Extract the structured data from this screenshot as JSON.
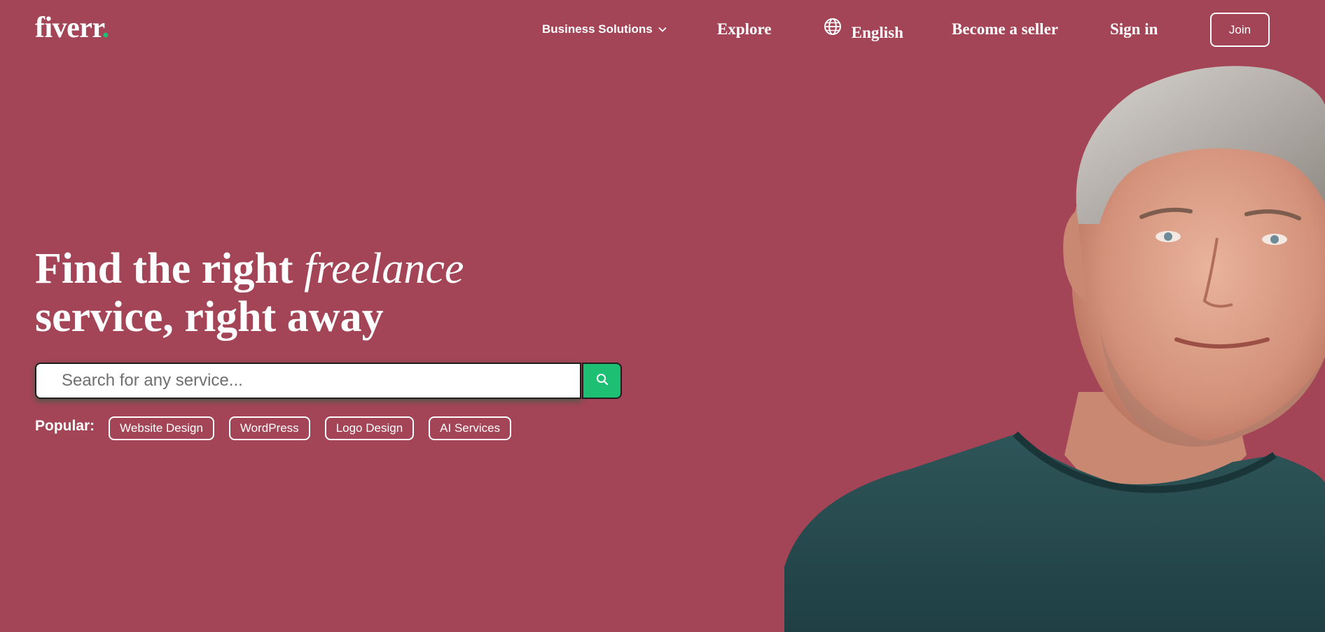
{
  "header": {
    "logo_text": "fiverr",
    "logo_dot": ".",
    "nav": {
      "business_solutions": "Business Solutions",
      "explore": "Explore",
      "language": "English",
      "become_seller": "Become a seller",
      "sign_in": "Sign in",
      "join": "Join"
    }
  },
  "hero": {
    "headline_part1": "Find the right ",
    "headline_emphasis": "freelance",
    "headline_part2": "service, right away",
    "search": {
      "placeholder": "Search for any service..."
    },
    "popular_label": "Popular:",
    "popular_tags": [
      "Website Design",
      "WordPress",
      "Logo Design",
      "AI Services"
    ]
  },
  "icons": {
    "search": "search-icon",
    "globe": "globe-icon",
    "chevron": "chevron-down-icon"
  },
  "colors": {
    "background": "#a34557",
    "accent": "#1dbf73",
    "text": "#ffffff"
  }
}
